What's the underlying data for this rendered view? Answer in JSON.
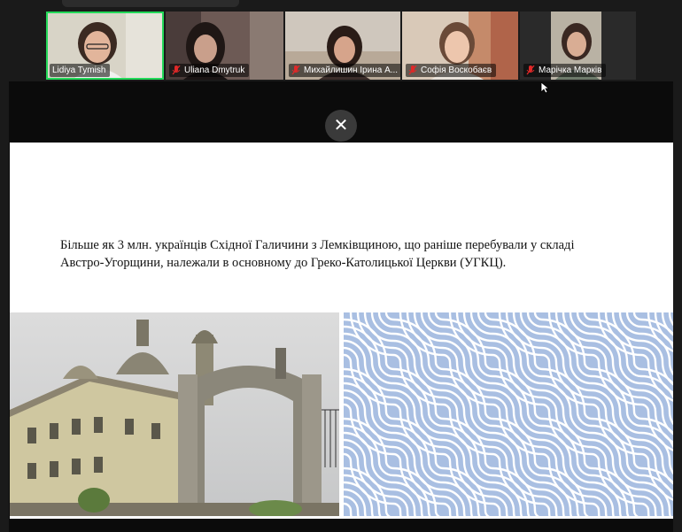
{
  "participants": [
    {
      "name": "Lidiya Tymish",
      "muted": false,
      "active": true
    },
    {
      "name": "Uliana Dmytruk",
      "muted": true,
      "active": false
    },
    {
      "name": "Михайлишин Ірина А...",
      "muted": true,
      "active": false
    },
    {
      "name": "Софія Воскобаєв",
      "muted": true,
      "active": false
    },
    {
      "name": "Марічка Марків",
      "muted": true,
      "active": false
    }
  ],
  "share": {
    "close_symbol": "✕"
  },
  "slide": {
    "line1": "Більше як 3 млн. українців Східної Галичини з Лемківщиною, що раніше перебували у складі",
    "line2": "Австро-Угорщини, належали в основному до Греко-Католицької Церкви (УГКЦ)."
  },
  "colors": {
    "active_speaker": "#23d959",
    "muted_icon": "#e02828",
    "pattern_bg": "#a9bfe2"
  }
}
